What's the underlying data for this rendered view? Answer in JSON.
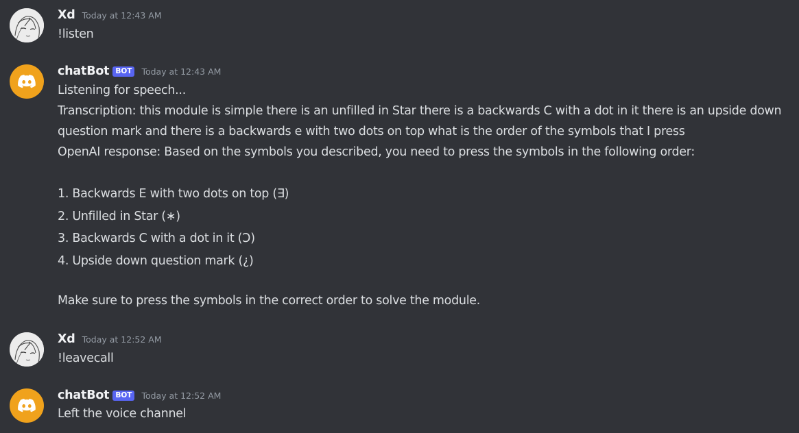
{
  "messages": [
    {
      "author": "Xd",
      "timestamp": "Today at 12:43 AM",
      "text": "!listen"
    },
    {
      "author": "chatBot",
      "badge": "BOT",
      "timestamp": "Today at 12:43 AM",
      "lines": [
        "Listening for speech...",
        "Transcription: this module is simple there is an unfilled in Star there is a backwards C with a dot in it there is an upside down",
        "question mark and there is a backwards e with two dots on top what is the order of the symbols that I press",
        "OpenAI response: Based on the symbols you described, you need to press the symbols in the following order:",
        "1. Backwards E with two dots on top (∃)",
        "2. Unfilled in Star (∗)",
        "3. Backwards C with a dot in it (Ↄ)",
        "4. Upside down question mark (¿)",
        "Make sure to press the symbols in the correct order to solve the module."
      ]
    },
    {
      "author": "Xd",
      "timestamp": "Today at 12:52 AM",
      "text": "!leavecall"
    },
    {
      "author": "chatBot",
      "badge": "BOT",
      "timestamp": "Today at 12:52 AM",
      "text": "Left the voice channel"
    }
  ],
  "icons": {
    "user_avatar": "anime-sketch-avatar-icon",
    "bot_avatar": "discord-logo-icon"
  },
  "colors": {
    "background": "#313338",
    "bot_avatar_bg": "#f0a21c",
    "bot_badge": "#5865f2",
    "username": "#f2f3f5",
    "text": "#dbdee1",
    "timestamp": "#949ba4"
  }
}
